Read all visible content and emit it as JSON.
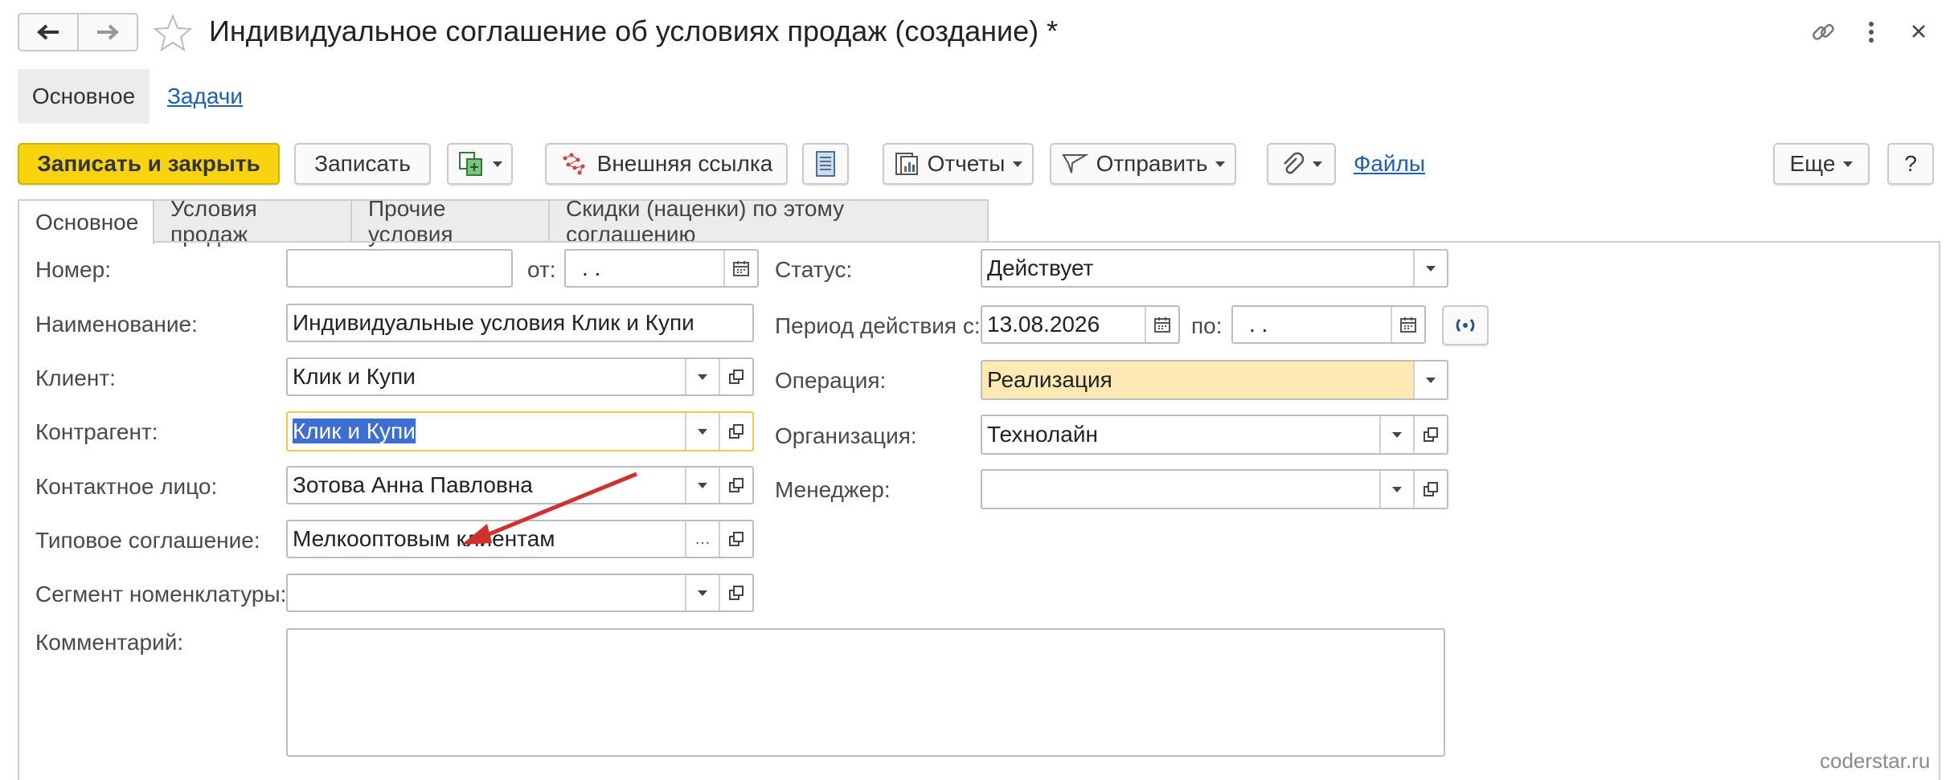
{
  "window": {
    "title": "Индивидуальное соглашение об условиях продаж (создание) *"
  },
  "nav": {
    "main_label": "Основное",
    "tasks_label": "Задачи"
  },
  "toolbar": {
    "save_close": "Записать и закрыть",
    "save": "Записать",
    "external_link": "Внешняя ссылка",
    "reports": "Отчеты",
    "send": "Отправить",
    "files": "Файлы",
    "more": "Еще",
    "help": "?"
  },
  "tabs": [
    {
      "label": "Основное"
    },
    {
      "label": "Условия продаж"
    },
    {
      "label": "Прочие условия"
    },
    {
      "label": "Скидки (наценки) по этому соглашению"
    }
  ],
  "form": {
    "number_label": "Номер:",
    "number_value": "",
    "from_label": "от:",
    "from_value": " .  .",
    "name_label": "Наименование:",
    "name_value": "Индивидуальные условия Клик и Купи",
    "client_label": "Клиент:",
    "client_value": "Клик и Купи",
    "counterparty_label": "Контрагент:",
    "counterparty_value": "Клик и Купи",
    "contact_label": "Контактное лицо:",
    "contact_value": "Зотова Анна Павловна",
    "standard_label": "Типовое соглашение:",
    "standard_value": "Мелкооптовым клиентам",
    "segment_label": "Сегмент номенклатуры:",
    "segment_value": "",
    "comment_label": "Комментарий:",
    "comment_value": "",
    "status_label": "Статус:",
    "status_value": "Действует",
    "period_label": "Период действия с:",
    "period_from": "13.08.2026",
    "period_to_label": "по:",
    "period_to": " .  .",
    "operation_label": "Операция:",
    "operation_value": "Реализация",
    "org_label": "Организация:",
    "org_value": "Технолайн",
    "manager_label": "Менеджер:",
    "manager_value": ""
  },
  "watermark": "coderstar.ru",
  "colors": {
    "primary_button": "#f8d40e",
    "highlight_field": "#fde9b3",
    "selection": "#3c6fd1",
    "annotation_arrow": "#d0312d"
  }
}
